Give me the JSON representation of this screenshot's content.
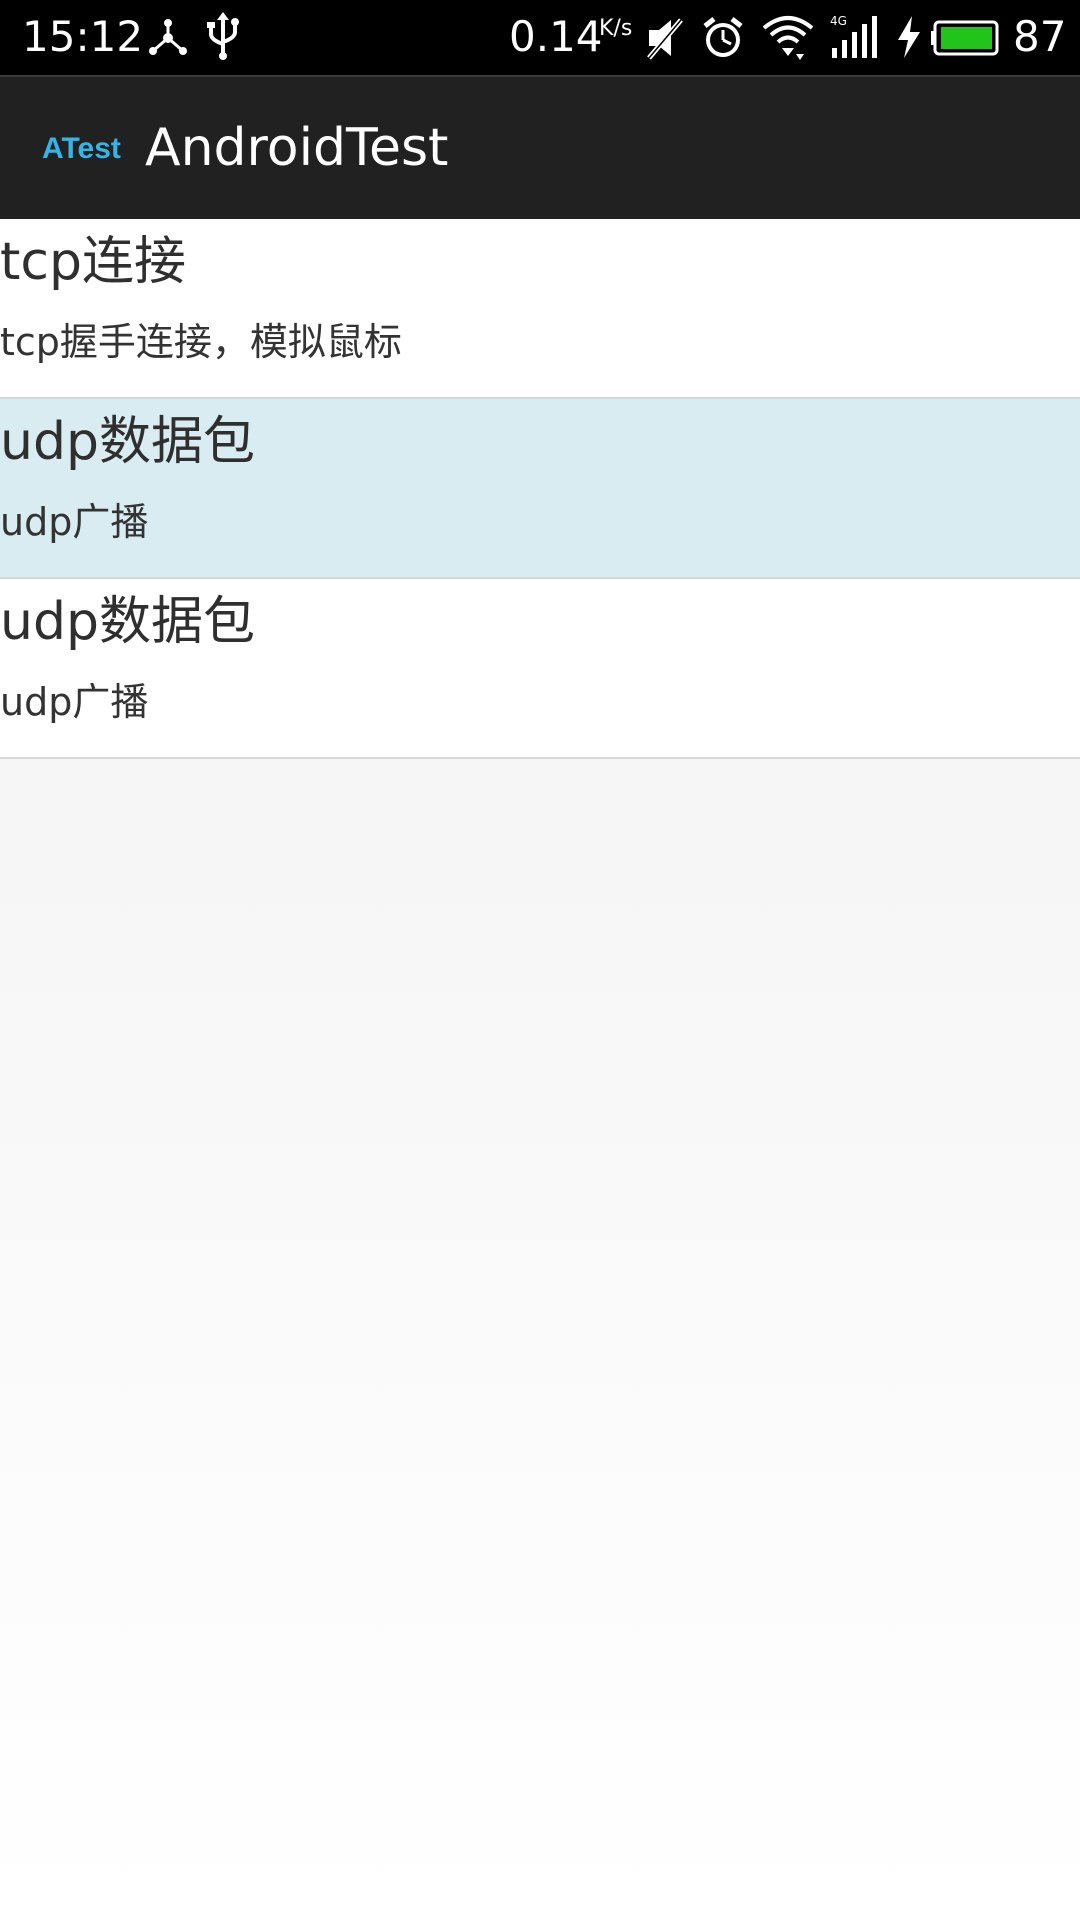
{
  "status_bar": {
    "time": "15:12",
    "network_speed": "0.14",
    "network_speed_unit": "K/s",
    "battery_level": "87",
    "icons": [
      "share-icon",
      "usb-icon",
      "mute-icon",
      "alarm-icon",
      "wifi-icon",
      "signal-4g-icon",
      "charging-icon",
      "battery-icon"
    ],
    "battery_color": "#22c31a"
  },
  "action_bar": {
    "logo_text": "ATest",
    "title": "AndroidTest",
    "background": "#212121",
    "logo_color": "#35b4e6"
  },
  "list": {
    "items": [
      {
        "title": "tcp连接",
        "subtitle": "tcp握手连接，模拟鼠标",
        "selected": false
      },
      {
        "title": "udp数据包",
        "subtitle": "udp广播",
        "selected": true
      },
      {
        "title": "udp数据包",
        "subtitle": "udp广播",
        "selected": false
      }
    ],
    "selected_color": "#d9ecf2"
  }
}
